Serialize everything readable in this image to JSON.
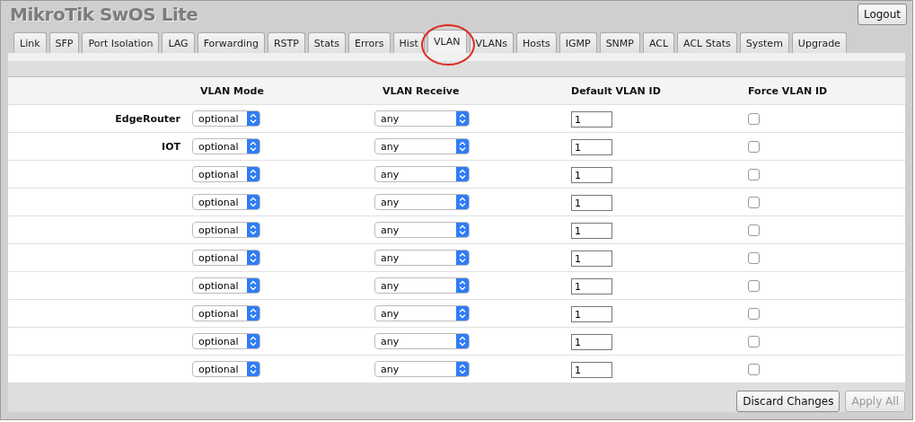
{
  "app_title": "MikroTik SwOS Lite",
  "logout": "Logout",
  "tabs": [
    {
      "label": "Link",
      "selected": false
    },
    {
      "label": "SFP",
      "selected": false
    },
    {
      "label": "Port Isolation",
      "selected": false
    },
    {
      "label": "LAG",
      "selected": false
    },
    {
      "label": "Forwarding",
      "selected": false
    },
    {
      "label": "RSTP",
      "selected": false
    },
    {
      "label": "Stats",
      "selected": false
    },
    {
      "label": "Errors",
      "selected": false
    },
    {
      "label": "Hist",
      "selected": false
    },
    {
      "label": "VLAN",
      "selected": true
    },
    {
      "label": "VLANs",
      "selected": false
    },
    {
      "label": "Hosts",
      "selected": false
    },
    {
      "label": "IGMP",
      "selected": false
    },
    {
      "label": "SNMP",
      "selected": false
    },
    {
      "label": "ACL",
      "selected": false
    },
    {
      "label": "ACL Stats",
      "selected": false
    },
    {
      "label": "System",
      "selected": false
    },
    {
      "label": "Upgrade",
      "selected": false
    }
  ],
  "table": {
    "columns": [
      "VLAN Mode",
      "VLAN Receive",
      "Default VLAN ID",
      "Force VLAN ID"
    ],
    "rows": [
      {
        "name": "EdgeRouter",
        "vlan_mode": "optional",
        "vlan_receive": "any",
        "default_vlan_id": "1",
        "force_vlan_id": false
      },
      {
        "name": "IOT",
        "vlan_mode": "optional",
        "vlan_receive": "any",
        "default_vlan_id": "1",
        "force_vlan_id": false
      },
      {
        "vlan_mode": "optional",
        "vlan_receive": "any",
        "default_vlan_id": "1",
        "force_vlan_id": false
      },
      {
        "vlan_mode": "optional",
        "vlan_receive": "any",
        "default_vlan_id": "1",
        "force_vlan_id": false
      },
      {
        "vlan_mode": "optional",
        "vlan_receive": "any",
        "default_vlan_id": "1",
        "force_vlan_id": false
      },
      {
        "vlan_mode": "optional",
        "vlan_receive": "any",
        "default_vlan_id": "1",
        "force_vlan_id": false
      },
      {
        "vlan_mode": "optional",
        "vlan_receive": "any",
        "default_vlan_id": "1",
        "force_vlan_id": false
      },
      {
        "vlan_mode": "optional",
        "vlan_receive": "any",
        "default_vlan_id": "1",
        "force_vlan_id": false
      },
      {
        "vlan_mode": "optional",
        "vlan_receive": "any",
        "default_vlan_id": "1",
        "force_vlan_id": false
      },
      {
        "vlan_mode": "optional",
        "vlan_receive": "any",
        "default_vlan_id": "1",
        "force_vlan_id": false
      }
    ]
  },
  "buttons": [
    {
      "label": "Discard Changes",
      "disabled": false
    },
    {
      "label": "Apply All",
      "disabled": true
    }
  ]
}
